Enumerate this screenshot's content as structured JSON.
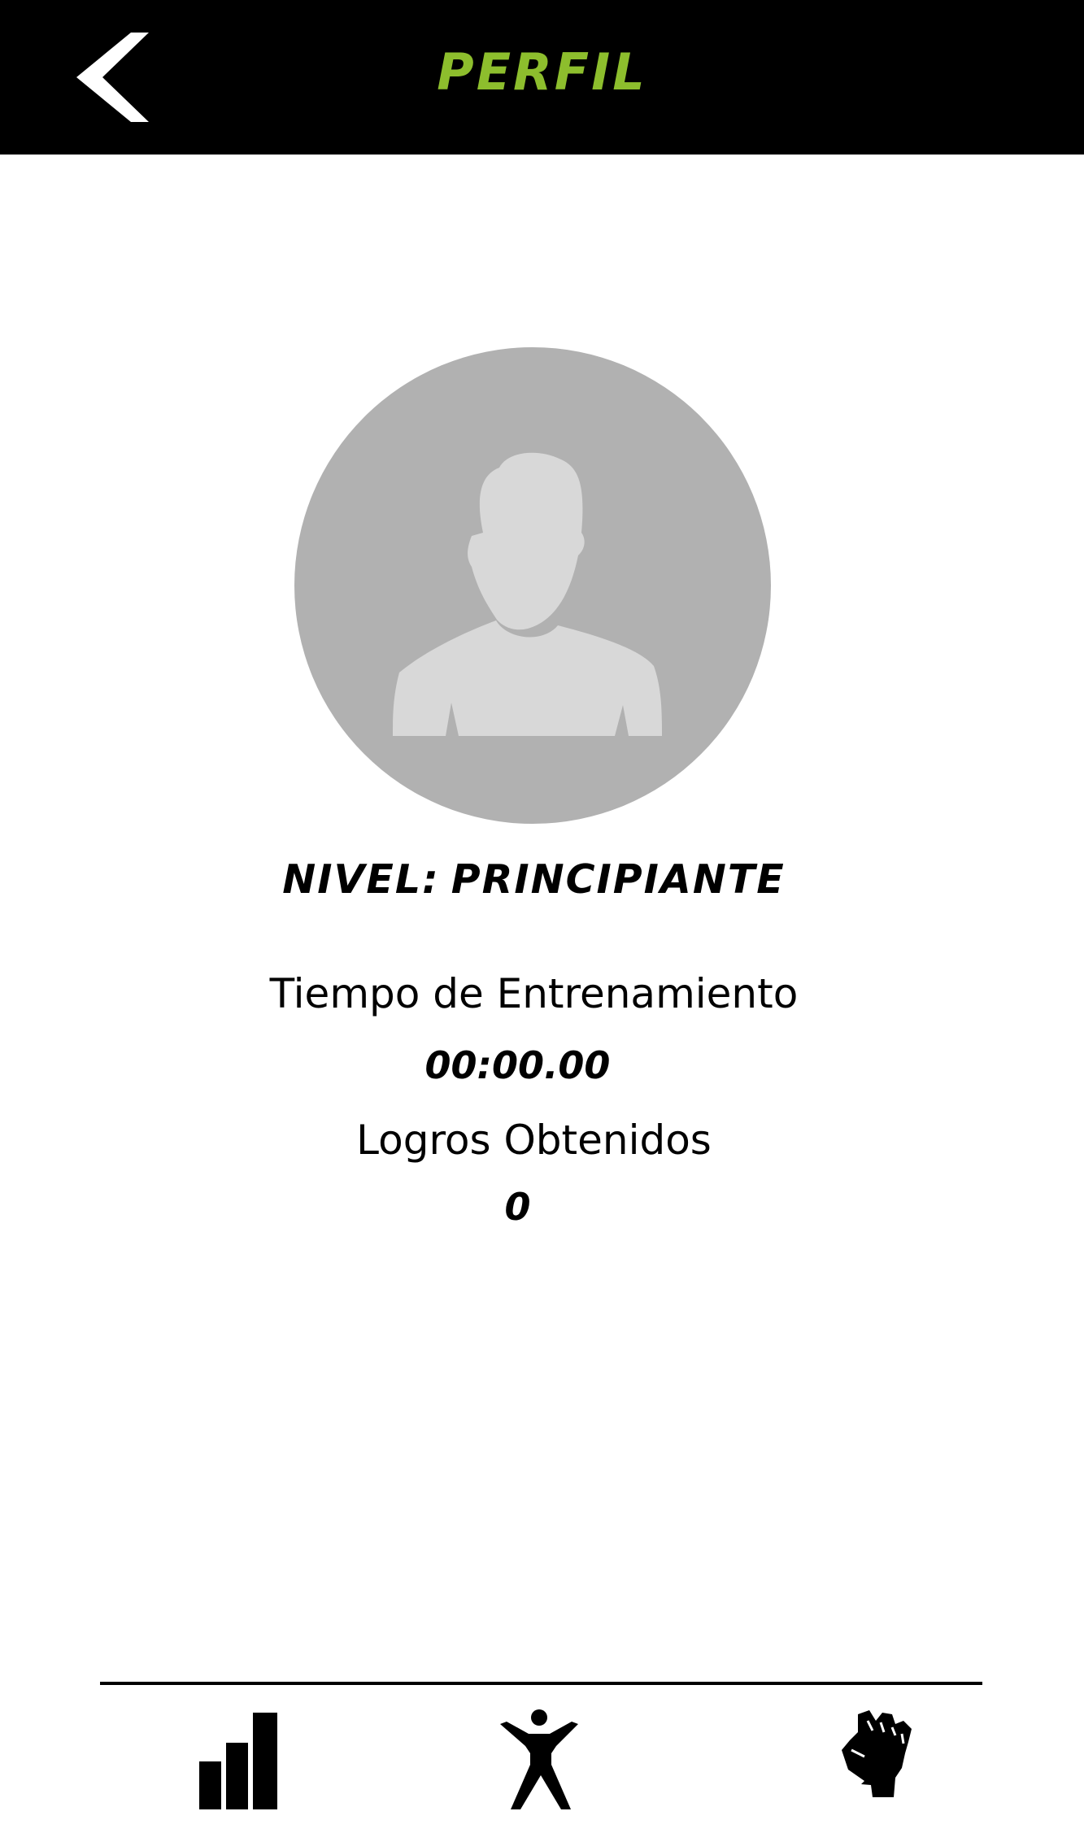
{
  "header": {
    "title": "PERFIL",
    "title_color": "#8dbe2d",
    "background": "#000000",
    "back_icon": "chevron-left-icon"
  },
  "profile": {
    "avatar_icon": "user-avatar-placeholder-icon",
    "level_label": "NIVEL:",
    "level_value": "PRINCIPIANTE",
    "training_time_label": "Tiempo de Entrenamiento",
    "training_time_value": "00:00.00",
    "achievements_label": "Logros Obtenidos",
    "achievements_value": "0"
  },
  "bottom_nav": {
    "items": [
      {
        "icon": "bar-chart-icon"
      },
      {
        "icon": "exercise-person-icon"
      },
      {
        "icon": "raised-fist-icon"
      }
    ]
  }
}
